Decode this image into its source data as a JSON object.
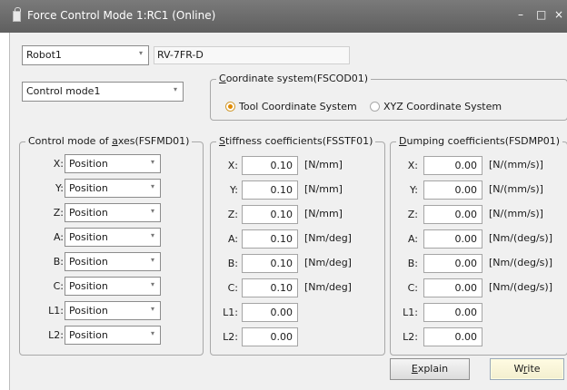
{
  "window": {
    "title": "Force Control Mode 1:RC1 (Online)",
    "minimize_glyph": "–",
    "maximize_glyph": "□",
    "close_glyph": "×"
  },
  "robot_select": {
    "value": "Robot1",
    "arrow": "▾"
  },
  "robot_model": "RV-7FR-D",
  "control_mode_select": {
    "value": "Control mode1",
    "arrow": "▾"
  },
  "coordinate_system": {
    "title_u": "C",
    "title_rest": "oordinate system(FSCOD01)",
    "options": [
      {
        "label": "Tool Coordinate System",
        "selected": true
      },
      {
        "label": "XYZ Coordinate System",
        "selected": false
      }
    ]
  },
  "axes_group": {
    "title_pre": "Control mode of ",
    "title_u": "a",
    "title_rest": "xes(FSFMD01)",
    "rows": [
      {
        "label": "X:",
        "value": "Position"
      },
      {
        "label": "Y:",
        "value": "Position"
      },
      {
        "label": "Z:",
        "value": "Position"
      },
      {
        "label": "A:",
        "value": "Position"
      },
      {
        "label": "B:",
        "value": "Position"
      },
      {
        "label": "C:",
        "value": "Position"
      },
      {
        "label": "L1:",
        "value": "Position"
      },
      {
        "label": "L2:",
        "value": "Position"
      }
    ]
  },
  "stiffness_group": {
    "title_u": "S",
    "title_rest": "tiffness coefficients(FSSTF01)",
    "rows": [
      {
        "label": "X:",
        "value": "0.10",
        "unit": "[N/mm]"
      },
      {
        "label": "Y:",
        "value": "0.10",
        "unit": "[N/mm]"
      },
      {
        "label": "Z:",
        "value": "0.10",
        "unit": "[N/mm]"
      },
      {
        "label": "A:",
        "value": "0.10",
        "unit": "[Nm/deg]"
      },
      {
        "label": "B:",
        "value": "0.10",
        "unit": "[Nm/deg]"
      },
      {
        "label": "C:",
        "value": "0.10",
        "unit": "[Nm/deg]"
      },
      {
        "label": "L1:",
        "value": "0.00",
        "unit": ""
      },
      {
        "label": "L2:",
        "value": "0.00",
        "unit": ""
      }
    ]
  },
  "damping_group": {
    "title_u": "D",
    "title_rest": "umping coefficients(FSDMP01)",
    "rows": [
      {
        "label": "X:",
        "value": "0.00",
        "unit": "[N/(mm/s)]"
      },
      {
        "label": "Y:",
        "value": "0.00",
        "unit": "[N/(mm/s)]"
      },
      {
        "label": "Z:",
        "value": "0.00",
        "unit": "[N/(mm/s)]"
      },
      {
        "label": "A:",
        "value": "0.00",
        "unit": "[Nm/(deg/s)]"
      },
      {
        "label": "B:",
        "value": "0.00",
        "unit": "[Nm/(deg/s)]"
      },
      {
        "label": "C:",
        "value": "0.00",
        "unit": "[Nm/(deg/s)]"
      },
      {
        "label": "L1:",
        "value": "0.00",
        "unit": ""
      },
      {
        "label": "L2:",
        "value": "0.00",
        "unit": ""
      }
    ]
  },
  "buttons": {
    "explain_u": "E",
    "explain_rest": "xplain",
    "write_pre": "W",
    "write_u": "r",
    "write_rest": "ite"
  },
  "colors": {
    "titlebar": "#6b6b6b",
    "dialog_bg": "#f0f0f0",
    "radio_selected": "#e08a00",
    "default_button": "#fffbe2"
  }
}
